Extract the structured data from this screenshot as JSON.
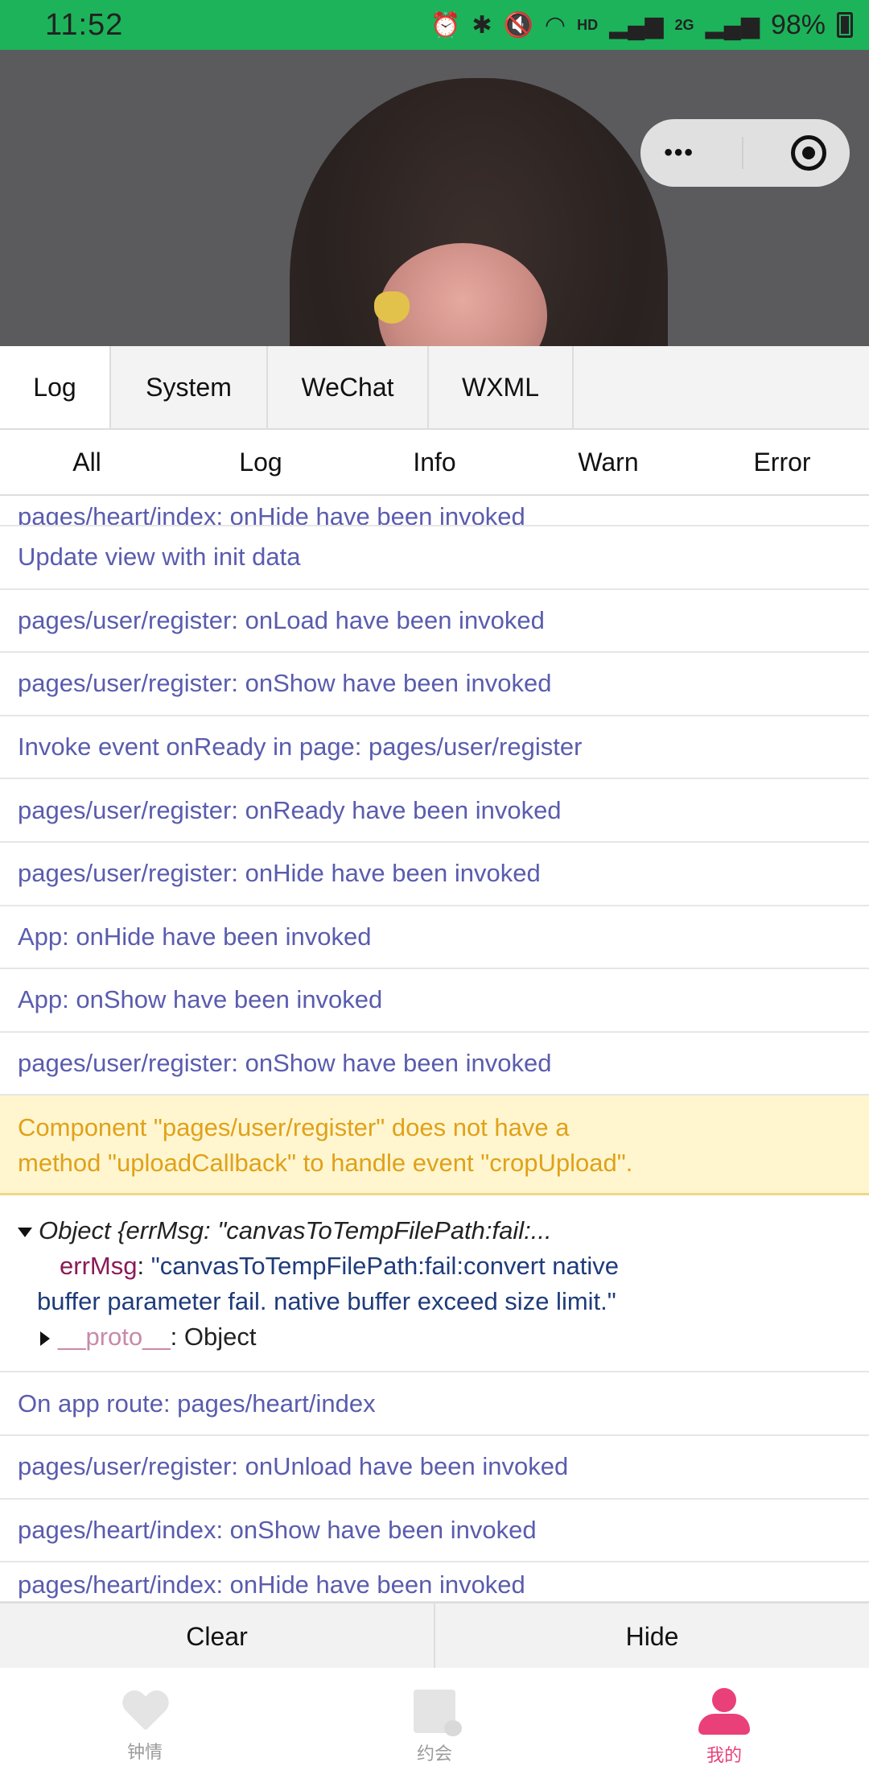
{
  "status_bar": {
    "time": "11:52",
    "network_label": "HD",
    "signal_label": "2G",
    "battery": "98%"
  },
  "capsule": {
    "more_icon": "more-dots-icon",
    "close_icon": "target-circle-icon"
  },
  "console": {
    "tabs": [
      "Log",
      "System",
      "WeChat",
      "WXML"
    ],
    "subtabs": [
      "All",
      "Log",
      "Info",
      "Warn",
      "Error"
    ],
    "logs": {
      "cut_top": "pages/heart/index: onHide have been invoked",
      "l1": "Update view with init data",
      "l2": "pages/user/register: onLoad have been invoked",
      "l3": "pages/user/register: onShow have been invoked",
      "l4": "Invoke event onReady in page: pages/user/register",
      "l5": "pages/user/register: onReady have been invoked",
      "l6": "pages/user/register: onHide have been invoked",
      "l7": "App: onHide have been invoked",
      "l8": "App: onShow have been invoked",
      "l9": "pages/user/register: onShow have been invoked",
      "warn_line1": "Component \"pages/user/register\" does not have a",
      "warn_line2": "method \"uploadCallback\" to handle event \"cropUpload\".",
      "obj_head": "Object {errMsg: \"canvasToTempFilePath:fail:...",
      "obj_key": "errMsg",
      "obj_colon": ": ",
      "obj_val_line1": "\"canvasToTempFilePath:fail:convert native",
      "obj_val_line2": "buffer parameter fail. native buffer exceed size limit.\"",
      "proto_key": "__proto__",
      "proto_val": ": Object",
      "l10": "On app route: pages/heart/index",
      "l11": "pages/user/register: onUnload have been invoked",
      "l12": "pages/heart/index: onShow have been invoked",
      "cut_bottom": "pages/heart/index: onHide have been invoked"
    },
    "footer": {
      "clear": "Clear",
      "hide": "Hide"
    }
  },
  "tabbar": {
    "items": [
      {
        "label": "钟情",
        "icon": "heart-icon"
      },
      {
        "label": "约会",
        "icon": "castle-icon"
      },
      {
        "label": "我的",
        "icon": "user-icon"
      }
    ],
    "active_color": "#e9407a"
  },
  "colors": {
    "status_bar_bg": "#1db35a",
    "log_text": "#5a5cae",
    "warn_bg": "#fff6cf",
    "warn_text": "#e0a11a"
  }
}
